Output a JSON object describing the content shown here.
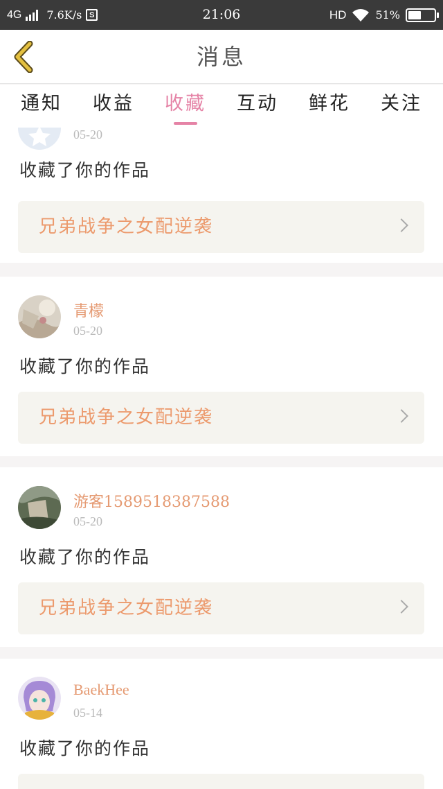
{
  "status_bar": {
    "network": "4G",
    "speed": "7.6K/s",
    "sim_icon_label": "S",
    "time": "21:06",
    "hd": "HD",
    "battery_pct": "51%",
    "battery_level": 0.51
  },
  "header": {
    "title": "消息",
    "back_icon": "chevron-left-icon",
    "accent": "#e0b838"
  },
  "tabs": [
    {
      "label": "通知",
      "active": false
    },
    {
      "label": "收益",
      "active": false
    },
    {
      "label": "收藏",
      "active": true
    },
    {
      "label": "互动",
      "active": false
    },
    {
      "label": "鲜花",
      "active": false
    },
    {
      "label": "关注",
      "active": false
    }
  ],
  "feed": [
    {
      "user": "",
      "date": "05-20",
      "action": "收藏了你的作品",
      "work": "兄弟战争之女配逆袭"
    },
    {
      "user": "青檬",
      "date": "05-20",
      "action": "收藏了你的作品",
      "work": "兄弟战争之女配逆袭"
    },
    {
      "user": "游客1589518387588",
      "date": "05-20",
      "action": "收藏了你的作品",
      "work": "兄弟战争之女配逆袭"
    },
    {
      "user": "BaekHee",
      "date": "05-14",
      "action": "收藏了你的作品",
      "work": ""
    }
  ],
  "colors": {
    "tab_active": "#e583a6",
    "username": "#e59a72",
    "work_title": "#ec9a6d",
    "work_bg": "#f5f4ef"
  }
}
